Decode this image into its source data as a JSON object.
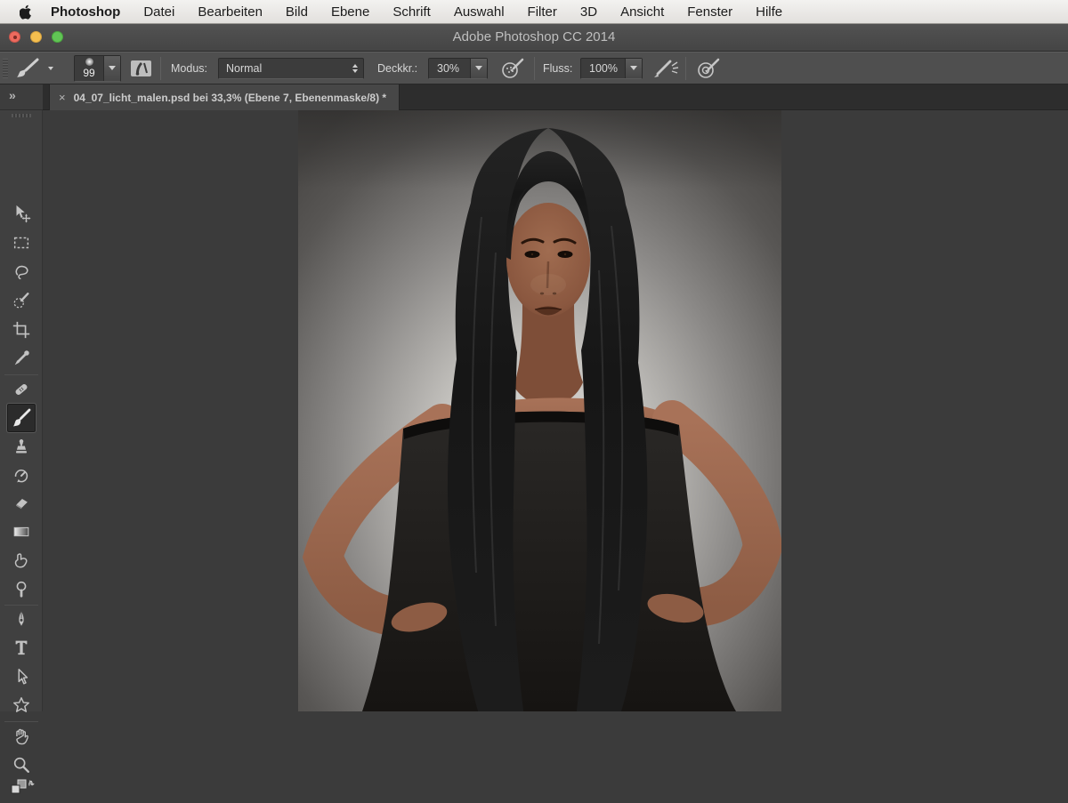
{
  "menubar": {
    "items": [
      "Photoshop",
      "Datei",
      "Bearbeiten",
      "Bild",
      "Ebene",
      "Schrift",
      "Auswahl",
      "Filter",
      "3D",
      "Ansicht",
      "Fenster",
      "Hilfe"
    ]
  },
  "titlebar": {
    "title": "Adobe Photoshop CC 2014"
  },
  "options_bar": {
    "brush_size": "99",
    "mode_label": "Modus:",
    "mode_value": "Normal",
    "opacity_label": "Deckkr.:",
    "opacity_value": "30%",
    "flow_label": "Fluss:",
    "flow_value": "100%"
  },
  "document_tab": {
    "close": "×",
    "title": "04_07_licht_malen.psd bei 33,3% (Ebene 7, Ebenenmaske/8) *"
  },
  "icons": {
    "collapse_panels": "»"
  },
  "toolbar": {
    "selected_tool": "brush"
  },
  "colors": {
    "workspace_bg": "#3b3b3b",
    "bar_bg": "#4f4f4f",
    "accent_text": "#d6d6d6",
    "traffic_red": "#ed6a5e",
    "traffic_yellow": "#f5bf4f",
    "traffic_green": "#61c455"
  }
}
